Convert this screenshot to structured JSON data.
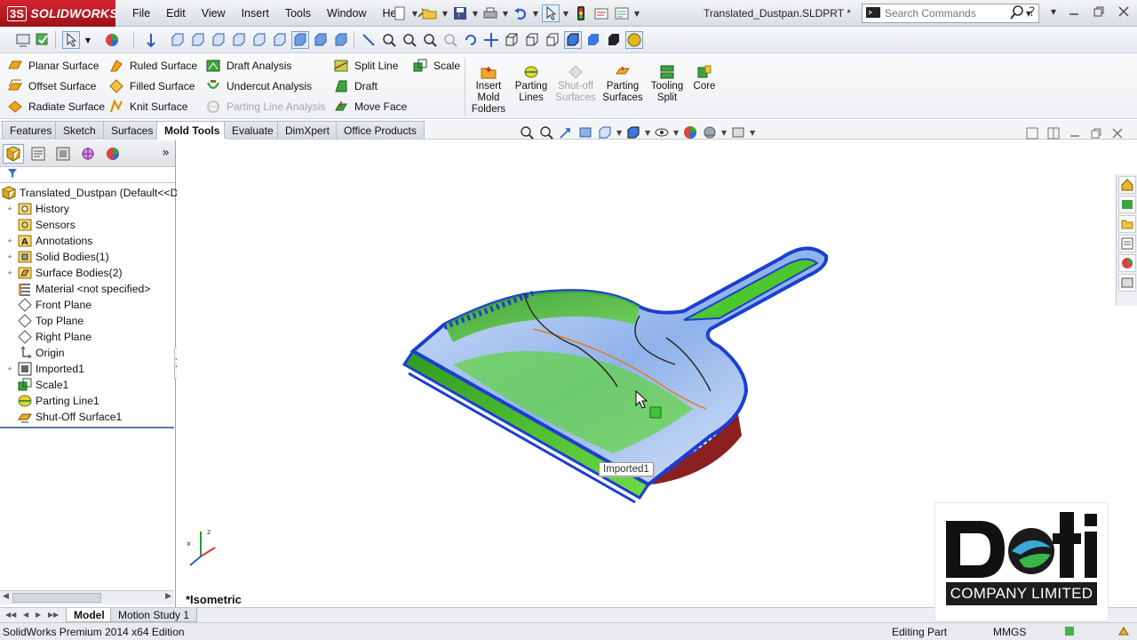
{
  "app": {
    "logo_text": "SOLIDWORKS",
    "document_title": "Translated_Dustpan.SLDPRT *",
    "menu": [
      "File",
      "Edit",
      "View",
      "Insert",
      "Tools",
      "Window",
      "Help"
    ],
    "search": {
      "placeholder": "Search Commands"
    }
  },
  "command_manager": {
    "small_commands": [
      {
        "label": "Planar Surface",
        "icon": "planar-surface-icon",
        "enabled": true
      },
      {
        "label": "Offset Surface",
        "icon": "offset-surface-icon",
        "enabled": true
      },
      {
        "label": "Radiate Surface",
        "icon": "radiate-surface-icon",
        "enabled": true
      },
      {
        "label": "Ruled Surface",
        "icon": "ruled-surface-icon",
        "enabled": true
      },
      {
        "label": "Filled Surface",
        "icon": "filled-surface-icon",
        "enabled": true
      },
      {
        "label": "Knit Surface",
        "icon": "knit-surface-icon",
        "enabled": true
      },
      {
        "label": "Draft Analysis",
        "icon": "draft-analysis-icon",
        "enabled": true
      },
      {
        "label": "Undercut Analysis",
        "icon": "undercut-analysis-icon",
        "enabled": true
      },
      {
        "label": "Parting Line Analysis",
        "icon": "parting-line-analysis-icon",
        "enabled": false
      },
      {
        "label": "Split Line",
        "icon": "split-line-icon",
        "enabled": true
      },
      {
        "label": "Draft",
        "icon": "draft-icon",
        "enabled": true
      },
      {
        "label": "Move Face",
        "icon": "move-face-icon",
        "enabled": true
      },
      {
        "label": "Scale",
        "icon": "scale-icon",
        "enabled": true
      }
    ],
    "big_commands": [
      {
        "line1": "Insert",
        "line2": "Mold",
        "line3": "Folders",
        "enabled": true
      },
      {
        "line1": "Parting",
        "line2": "Lines",
        "line3": "",
        "enabled": true
      },
      {
        "line1": "Shut-off",
        "line2": "Surfaces",
        "line3": "",
        "enabled": false
      },
      {
        "line1": "Parting",
        "line2": "Surfaces",
        "line3": "",
        "enabled": true
      },
      {
        "line1": "Tooling",
        "line2": "Split",
        "line3": "",
        "enabled": true
      },
      {
        "line1": "Core",
        "line2": "",
        "line3": "",
        "enabled": true
      }
    ]
  },
  "tabs": [
    "Features",
    "Sketch",
    "Surfaces",
    "Mold Tools",
    "Evaluate",
    "DimXpert",
    "Office Products"
  ],
  "active_tab": "Mold Tools",
  "feature_tree": {
    "root": "Translated_Dustpan  (Default<<D",
    "items": [
      {
        "label": "History",
        "icon": "history-folder-icon",
        "expandable": true
      },
      {
        "label": "Sensors",
        "icon": "sensors-icon",
        "expandable": false
      },
      {
        "label": "Annotations",
        "icon": "annotations-icon",
        "expandable": true
      },
      {
        "label": "Solid Bodies(1)",
        "icon": "solid-bodies-icon",
        "expandable": true
      },
      {
        "label": "Surface Bodies(2)",
        "icon": "surface-bodies-icon",
        "expandable": true
      },
      {
        "label": "Material <not specified>",
        "icon": "material-icon",
        "expandable": false
      },
      {
        "label": "Front Plane",
        "icon": "plane-icon",
        "expandable": false
      },
      {
        "label": "Top Plane",
        "icon": "plane-icon",
        "expandable": false
      },
      {
        "label": "Right Plane",
        "icon": "plane-icon",
        "expandable": false
      },
      {
        "label": "Origin",
        "icon": "origin-icon",
        "expandable": false
      },
      {
        "label": "Imported1",
        "icon": "imported-icon",
        "expandable": true
      },
      {
        "label": "Scale1",
        "icon": "scale-feature-icon",
        "expandable": false
      },
      {
        "label": "Parting Line1",
        "icon": "parting-line-icon",
        "expandable": false
      },
      {
        "label": "Shut-Off Surface1",
        "icon": "shutoff-surface-icon",
        "expandable": false
      }
    ]
  },
  "viewport": {
    "view_name": "*Isometric",
    "tooltip": "Imported1"
  },
  "bottom_tabs": [
    "Model",
    "Motion Study 1"
  ],
  "status": {
    "edition": "SolidWorks Premium 2014 x64 Edition",
    "mode": "Editing Part",
    "units": "MMGS"
  },
  "watermark": {
    "logo_word": "Deti",
    "company": "COMPANY LIMITED"
  },
  "colors": {
    "accent_red": "#c8202b",
    "model_blue": "#2a49d6",
    "model_green": "#47c52a",
    "model_face": "#b7cff1"
  }
}
